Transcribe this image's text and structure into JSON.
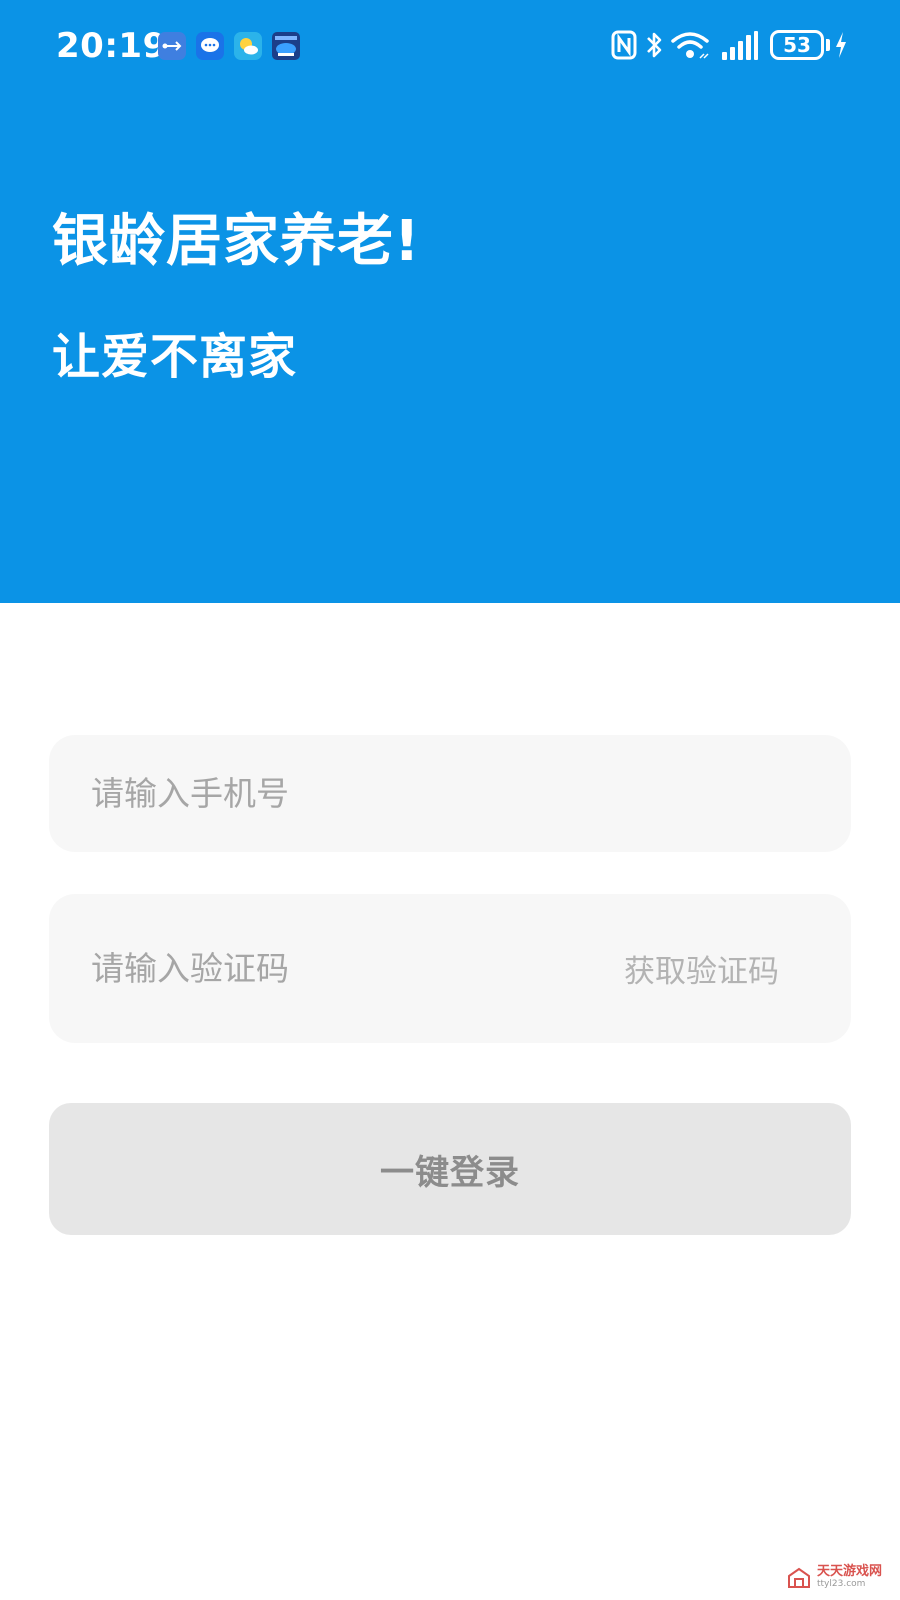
{
  "status_bar": {
    "time": "20:19",
    "battery_level": "53",
    "notification_icons": [
      "usb-icon",
      "message-icon",
      "weather-icon",
      "app-icon"
    ],
    "system_icons": [
      "nfc-icon",
      "bluetooth-icon",
      "wifi-icon",
      "signal-icon",
      "battery-icon",
      "charging-icon"
    ]
  },
  "hero": {
    "title": "银龄居家养老!",
    "subtitle": "让爱不离家",
    "background_color": "#0b93e6"
  },
  "form": {
    "phone_placeholder": "请输入手机号",
    "phone_value": "",
    "code_placeholder": "请输入验证码",
    "code_value": "",
    "get_code_label": "获取验证码",
    "login_label": "一键登录"
  },
  "watermark": {
    "text": "天天游戏网",
    "url": "ttyl23.com"
  }
}
